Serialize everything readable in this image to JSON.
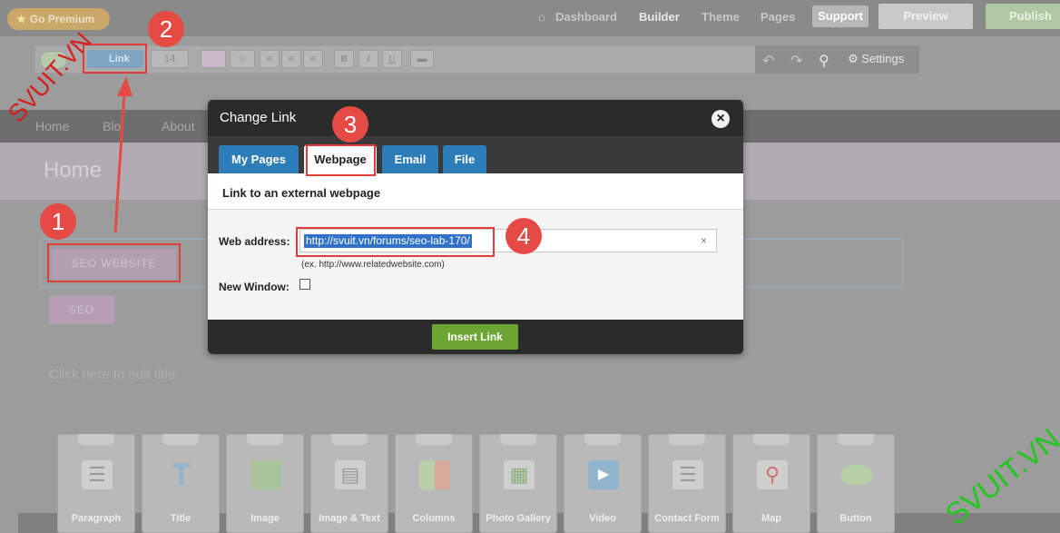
{
  "topbar": {
    "go_premium": "Go Premium",
    "nav": [
      "Dashboard",
      "Builder",
      "Theme",
      "Pages"
    ],
    "support": "Support",
    "preview": "Preview",
    "publish": "Publish"
  },
  "toolbar": {
    "link_label": "Link",
    "font_size": "14",
    "settings_label": "Settings"
  },
  "site": {
    "nav": [
      "Home",
      "Blog",
      "About"
    ],
    "page_title": "Home",
    "button_seo_website": "SEO WEBSITE",
    "button_seo": "SEO",
    "edit_title_placeholder": "Click here to edit title."
  },
  "widgets": [
    "Paragraph",
    "Title",
    "Image",
    "Image & Text",
    "Columns",
    "Photo Gallery",
    "Video",
    "Contact Form",
    "Map",
    "Button"
  ],
  "modal": {
    "title": "Change Link",
    "tabs": [
      "My Pages",
      "Webpage",
      "Email",
      "File"
    ],
    "active_tab": "Webpage",
    "description": "Link to an external webpage",
    "web_address_label": "Web address:",
    "web_address_value": "http://svuit.vn/forums/seo-lab-170/",
    "hint": "(ex. http://www.relatedwebsite.com)",
    "new_window_label": "New Window:",
    "new_window_checked": false,
    "insert_button": "Insert Link"
  },
  "annotations": {
    "steps": [
      "1",
      "2",
      "3",
      "4"
    ],
    "watermark": "SVUIT.VN"
  },
  "colors": {
    "modal_header": "#2b2b2b",
    "tab_blue": "#2d7db9",
    "insert_green": "#6aa631",
    "annotation_red": "#e03c3c",
    "watermark_green": "#22c61e"
  }
}
